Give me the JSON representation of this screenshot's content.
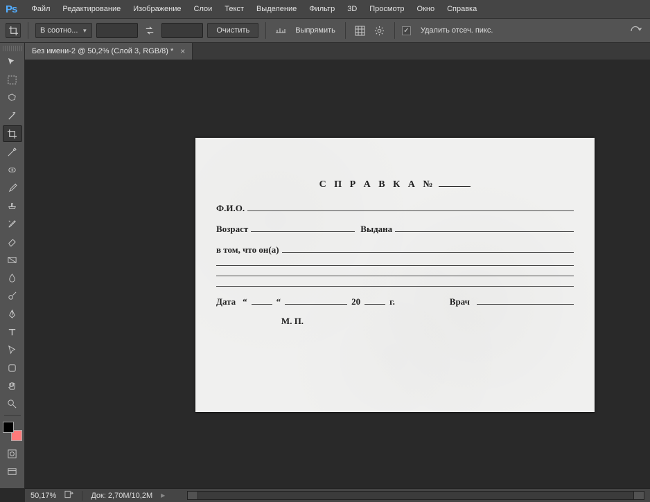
{
  "menubar": {
    "items": [
      "Файл",
      "Редактирование",
      "Изображение",
      "Слои",
      "Текст",
      "Выделение",
      "Фильтр",
      "3D",
      "Просмотр",
      "Окно",
      "Справка"
    ]
  },
  "optionsbar": {
    "aspect_label": "В соотно...",
    "clear_label": "Очистить",
    "straighten_label": "Выпрямить",
    "delete_pixels_label": "Удалить отсеч. пикс."
  },
  "tab": {
    "title": "Без имени-2 @ 50,2% (Слой 3, RGB/8) *"
  },
  "document": {
    "title": "С П Р А В К А №",
    "fio_label": "Ф.И.О.",
    "age_label": "Возраст",
    "issued_label": "Выдана",
    "that_label": "в том, что он(а)",
    "date_label": "Дата",
    "quote1": "“",
    "quote2": "“",
    "year_label": "20",
    "year_suffix": "г.",
    "doctor_label": "Врач",
    "stamp_label": "М. П."
  },
  "statusbar": {
    "zoom": "50,17%",
    "doc_info": "Док: 2,70M/10,2M"
  }
}
